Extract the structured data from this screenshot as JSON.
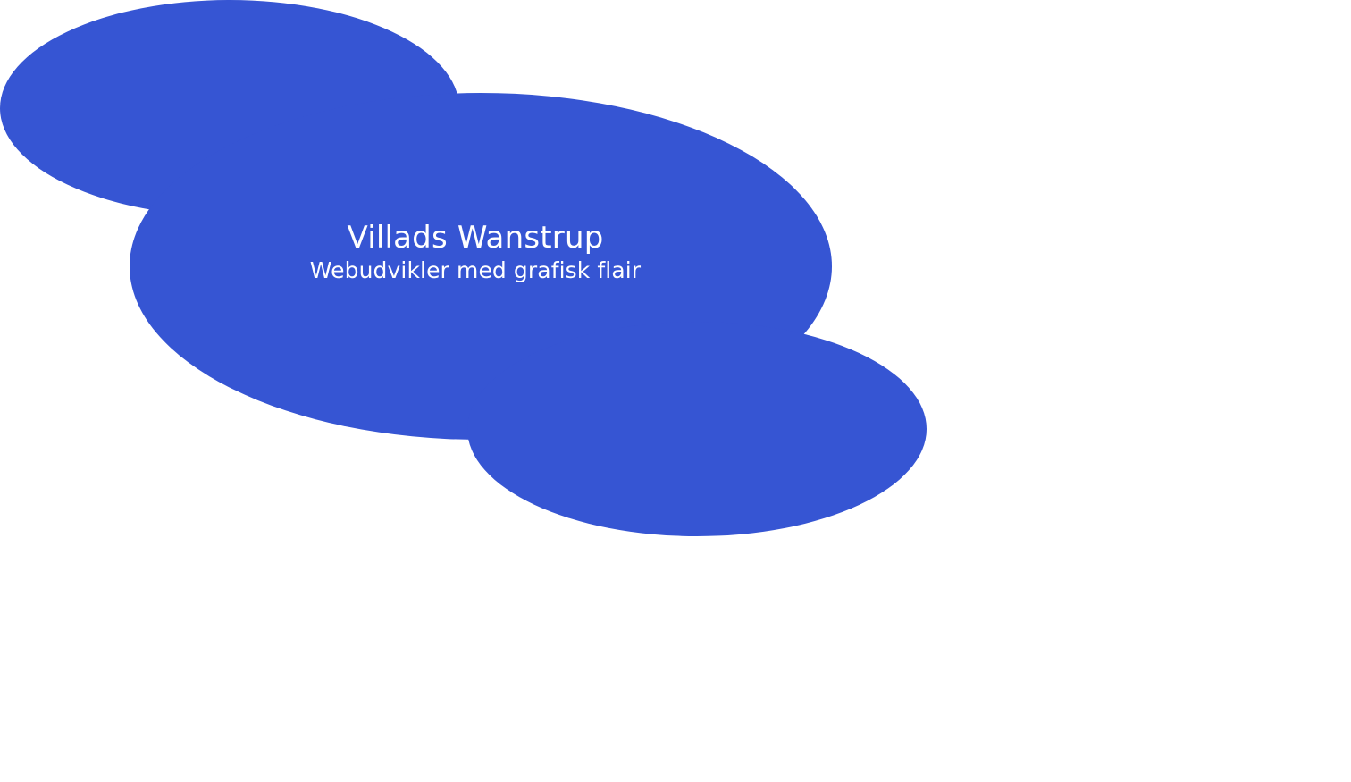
{
  "hero": {
    "name": "Villads Wanstrup",
    "tagline": "Webudvikler med grafisk flair"
  },
  "colors": {
    "background": "#ffffff",
    "blob": "#3655d3",
    "text": "#ffffff"
  }
}
